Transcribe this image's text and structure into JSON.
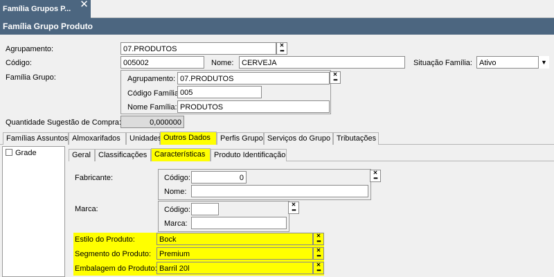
{
  "doc_tab": {
    "label": "Família Grupos P...",
    "close": "✕"
  },
  "title": "Família Grupo Produto",
  "form": {
    "agrupamento_label": "Agrupamento:",
    "agrupamento_value": "07.PRODUTOS",
    "codigo_label": "Código:",
    "codigo_value": "005002",
    "nome_label": "Nome:",
    "nome_value": "CERVEJA",
    "situacao_label": "Situação Família:",
    "situacao_value": "Ativo",
    "familia_grupo_label": "Família Grupo:",
    "fg_agrupamento_label": "Agrupamento:",
    "fg_agrupamento_value": "07.PRODUTOS",
    "fg_codigo_label": "Código Família:",
    "fg_codigo_value": "005",
    "fg_nome_label": "Nome Família:",
    "fg_nome_value": "PRODUTOS",
    "qtd_label": "Quantidade Sugestão de Compra:",
    "qtd_value": "0,000000"
  },
  "main_tabs": [
    "Famílias Assuntos",
    "Almoxarifados",
    "Unidades",
    "Outros Dados",
    "Perfis Grupo",
    "Serviços do Grupo",
    "Tributações"
  ],
  "left_list": {
    "item": "Grade"
  },
  "sub_tabs": [
    "Geral",
    "Classificações",
    "Características",
    "Produto Identificação"
  ],
  "chars": {
    "fabricante_label": "Fabricante:",
    "fab_codigo_label": "Código:",
    "fab_codigo_value": "0",
    "fab_nome_label": "Nome:",
    "fab_nome_value": "",
    "marca_label": "Marca:",
    "marca_codigo_label": "Código:",
    "marca_codigo_value": "",
    "marca_marca_label": "Marca:",
    "marca_marca_value": "",
    "estilo_label": "Estilo do Produto:",
    "estilo_value": "Bock",
    "segmento_label": "Segmento do Produto:",
    "segmento_value": "Premium",
    "embalagem_label": "Embalagem do Produto:",
    "embalagem_value": "Barril 20l"
  },
  "colors": {
    "header": "#4c6680",
    "highlight": "#ffff00"
  }
}
